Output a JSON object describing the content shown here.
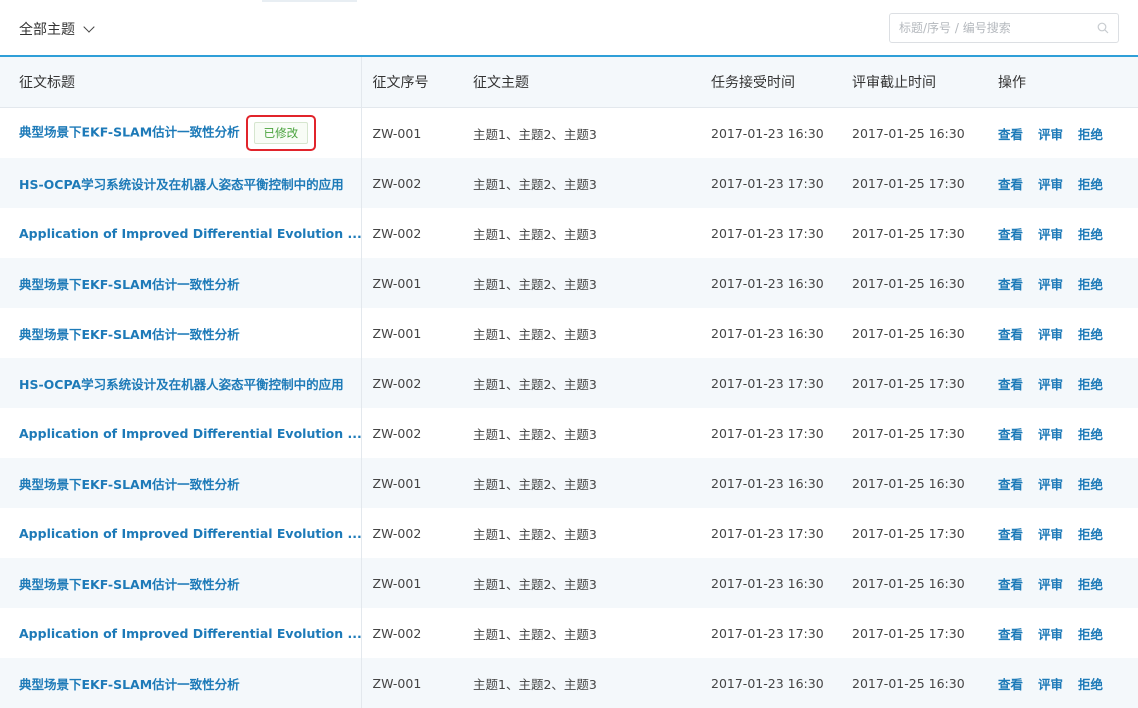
{
  "filter": {
    "label": "全部主题"
  },
  "search": {
    "placeholder": "标题/序号 / 编号搜索"
  },
  "table": {
    "headers": {
      "title": "征文标题",
      "serial": "征文序号",
      "topics": "征文主题",
      "accept_time": "任务接受时间",
      "deadline": "评审截止时间",
      "actions": "操作"
    },
    "modified_badge": "已修改",
    "actions": {
      "view": "查看",
      "review": "评审",
      "reject": "拒绝"
    },
    "rows": [
      {
        "title": "典型场景下EKF-SLAM估计一致性分析",
        "serial": "ZW-001",
        "topics": "主题1、主题2、主题3",
        "accept_time": "2017-01-23 16:30",
        "deadline": "2017-01-25 16:30",
        "modified": true
      },
      {
        "title": "HS-OCPA学习系统设计及在机器人姿态平衡控制中的应用",
        "serial": "ZW-002",
        "topics": "主题1、主题2、主题3",
        "accept_time": "2017-01-23 17:30",
        "deadline": "2017-01-25 17:30",
        "modified": false
      },
      {
        "title": "Application of Improved Differential Evolution ...",
        "serial": "ZW-002",
        "topics": "主题1、主题2、主题3",
        "accept_time": "2017-01-23 17:30",
        "deadline": "2017-01-25 17:30",
        "modified": false
      },
      {
        "title": "典型场景下EKF-SLAM估计一致性分析",
        "serial": "ZW-001",
        "topics": "主题1、主题2、主题3",
        "accept_time": "2017-01-23 16:30",
        "deadline": "2017-01-25 16:30",
        "modified": false
      },
      {
        "title": "典型场景下EKF-SLAM估计一致性分析",
        "serial": "ZW-001",
        "topics": "主题1、主题2、主题3",
        "accept_time": "2017-01-23 16:30",
        "deadline": "2017-01-25 16:30",
        "modified": false
      },
      {
        "title": "HS-OCPA学习系统设计及在机器人姿态平衡控制中的应用",
        "serial": "ZW-002",
        "topics": "主题1、主题2、主题3",
        "accept_time": "2017-01-23 17:30",
        "deadline": "2017-01-25 17:30",
        "modified": false
      },
      {
        "title": "Application of Improved Differential Evolution ...",
        "serial": "ZW-002",
        "topics": "主题1、主题2、主题3",
        "accept_time": "2017-01-23 17:30",
        "deadline": "2017-01-25 17:30",
        "modified": false
      },
      {
        "title": "典型场景下EKF-SLAM估计一致性分析",
        "serial": "ZW-001",
        "topics": "主题1、主题2、主题3",
        "accept_time": "2017-01-23 16:30",
        "deadline": "2017-01-25 16:30",
        "modified": false
      },
      {
        "title": "Application of Improved Differential Evolution ...",
        "serial": "ZW-002",
        "topics": "主题1、主题2、主题3",
        "accept_time": "2017-01-23 17:30",
        "deadline": "2017-01-25 17:30",
        "modified": false
      },
      {
        "title": "典型场景下EKF-SLAM估计一致性分析",
        "serial": "ZW-001",
        "topics": "主题1、主题2、主题3",
        "accept_time": "2017-01-23 16:30",
        "deadline": "2017-01-25 16:30",
        "modified": false
      },
      {
        "title": "Application of Improved Differential Evolution ...",
        "serial": "ZW-002",
        "topics": "主题1、主题2、主题3",
        "accept_time": "2017-01-23 17:30",
        "deadline": "2017-01-25 17:30",
        "modified": false
      },
      {
        "title": "典型场景下EKF-SLAM估计一致性分析",
        "serial": "ZW-001",
        "topics": "主题1、主题2、主题3",
        "accept_time": "2017-01-23 16:30",
        "deadline": "2017-01-25 16:30",
        "modified": false
      }
    ]
  },
  "colors": {
    "accent_blue": "#2f9fd8",
    "link_blue": "#1d7ab8",
    "deadline_red": "#e1242b",
    "badge_green": "#4aa33e",
    "zebra": "#f4f8fb"
  }
}
